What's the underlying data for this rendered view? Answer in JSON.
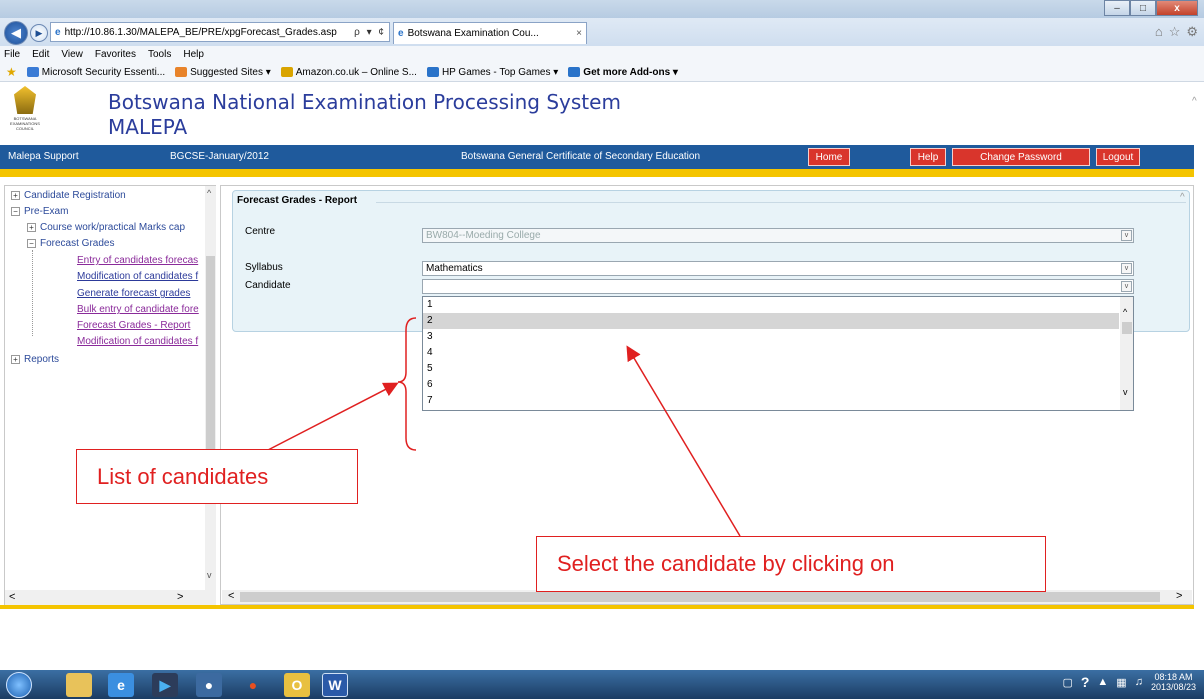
{
  "browser": {
    "address_url": "http://10.86.1.30/MALEPA_BE/PRE/xpgForecast_Grades.asp",
    "address_controls": "ρ ▾ ¢",
    "tab_title": "Botswana Examination Cou...",
    "tab_close": "×",
    "window_min": "–",
    "window_max": "□",
    "window_close": "x",
    "chrome_icons": [
      "⌂",
      "☆",
      "⚙"
    ],
    "menu": [
      "File",
      "Edit",
      "View",
      "Favorites",
      "Tools",
      "Help"
    ],
    "favorites": [
      {
        "label": "Microsoft Security Essenti...",
        "color": "#3a7bd5"
      },
      {
        "label": "Suggested Sites ▾",
        "color": "#e8832a"
      },
      {
        "label": "Amazon.co.uk – Online S...",
        "color": "#d9a400"
      },
      {
        "label": "HP Games - Top Games ▾",
        "color": "#2a73c9"
      },
      {
        "label": "Get more Add-ons ▾",
        "color": "#2a73c9"
      }
    ]
  },
  "header": {
    "title": "Botswana National Examination Processing System",
    "subtitle": "MALEPA",
    "logo_caption": "BOTSWANA EXAMINATIONS COUNCIL"
  },
  "bluebar": {
    "support": "Malepa Support",
    "session": "BGCSE-January/2012",
    "exam": "Botswana General Certificate of Secondary Education",
    "home": "Home",
    "help": "Help",
    "change_password": "Change Password",
    "logout": "Logout"
  },
  "tree": {
    "candidate_registration": "Candidate Registration",
    "pre_exam": "Pre-Exam",
    "course_work": "Course work/practical Marks cap",
    "forecast_grades": "Forecast Grades",
    "leaves": [
      "Entry of candidates forecas",
      "Modification of candidates f",
      "Generate forecast grades",
      "Bulk entry of candidate fore",
      "Forecast Grades - Report",
      "Modification of candidates f"
    ],
    "reports": "Reports",
    "scroll_left": "<",
    "scroll_right": ">",
    "scroll_up": "^",
    "scroll_down": "v"
  },
  "form": {
    "title": "Forecast Grades - Report",
    "centre_label": "Centre",
    "centre_value": "BW804--Moeding College",
    "syllabus_label": "Syllabus",
    "syllabus_value": "Mathematics",
    "candidate_label": "Candidate",
    "candidate_value": "",
    "dropdown_arrow": "v"
  },
  "dropdown": {
    "options": [
      "1",
      "2",
      "3",
      "4",
      "5",
      "6",
      "7"
    ],
    "selected_index": 1,
    "scroll_up": "^",
    "scroll_down": "v"
  },
  "annotations": {
    "list_label": "List of candidates",
    "select_label": "Select the candidate by clicking on",
    "color": "#e02020"
  },
  "scrollbars": {
    "right_left": "<",
    "right_right": ">",
    "page_up": "^"
  },
  "taskbar": {
    "time": "08:18 AM",
    "date": "2013/08/23"
  }
}
